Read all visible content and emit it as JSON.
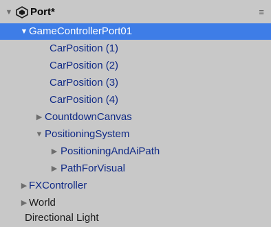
{
  "scene": {
    "name": "Port*",
    "icon": "unity-scene-icon",
    "menu_icon": "≡"
  },
  "hierarchy": [
    {
      "label": "GameControllerPort01",
      "arrow": "▼",
      "type": "prefab",
      "selected": true
    },
    {
      "label": "CarPosition (1)",
      "arrow": "",
      "type": "prefab"
    },
    {
      "label": "CarPosition (2)",
      "arrow": "",
      "type": "prefab"
    },
    {
      "label": "CarPosition (3)",
      "arrow": "",
      "type": "prefab"
    },
    {
      "label": "CarPosition (4)",
      "arrow": "",
      "type": "prefab"
    },
    {
      "label": "CountdownCanvas",
      "arrow": "▶",
      "type": "prefab"
    },
    {
      "label": "PositioningSystem",
      "arrow": "▼",
      "type": "prefab"
    },
    {
      "label": "PositioningAndAiPath",
      "arrow": "▶",
      "type": "prefab"
    },
    {
      "label": "PathForVisual",
      "arrow": "▶",
      "type": "prefab"
    },
    {
      "label": "FXController",
      "arrow": "▶",
      "type": "prefab"
    },
    {
      "label": "World",
      "arrow": "▶",
      "type": "plain"
    },
    {
      "label": "Directional Light",
      "arrow": "",
      "type": "plain"
    }
  ],
  "colors": {
    "background": "#c8c8c8",
    "selection": "#3e7de7",
    "prefab_text": "#102a86",
    "plain_text": "#1a1a1a"
  }
}
